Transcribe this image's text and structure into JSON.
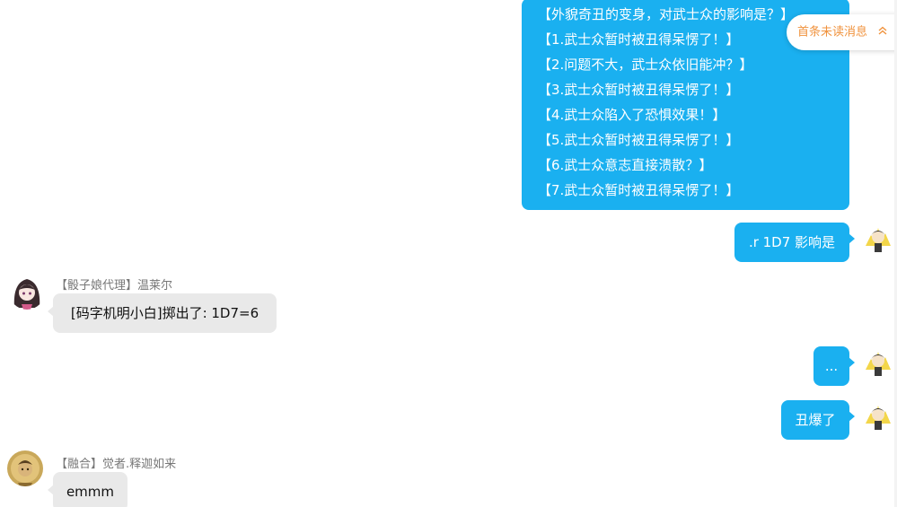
{
  "messages": {
    "m1": {
      "lines": [
        "【外貌奇丑的变身，对武士众的影响是？】",
        "【1.武士众暂时被丑得呆愣了！】",
        "【2.问题不大，武士众依旧能冲？】",
        "【3.武士众暂时被丑得呆愣了！】",
        "【4.武士众陷入了恐惧效果！】",
        "【5.武士众暂时被丑得呆愣了！】",
        "【6.武士众意志直接溃散？】",
        "【7.武士众暂时被丑得呆愣了！】"
      ]
    },
    "m2": {
      "text": ".r 1D7 影响是"
    },
    "m3": {
      "sender": "【骰子娘代理】温莱尔",
      "text": "[码字机明小白]掷出了: 1D7=6"
    },
    "m4": {
      "text": "..."
    },
    "m5": {
      "text": "丑爆了"
    },
    "m6": {
      "sender": "【融合】觉者.释迦如来",
      "text": "emmm"
    }
  },
  "unread_button": {
    "label": "首条未读消息",
    "icon": "double-chevron-up-icon"
  },
  "colors": {
    "my_bubble": "#1ab0f0",
    "other_bubble": "#e9e9e9",
    "unread_text": "#f0923c",
    "sender_text": "#777777"
  }
}
